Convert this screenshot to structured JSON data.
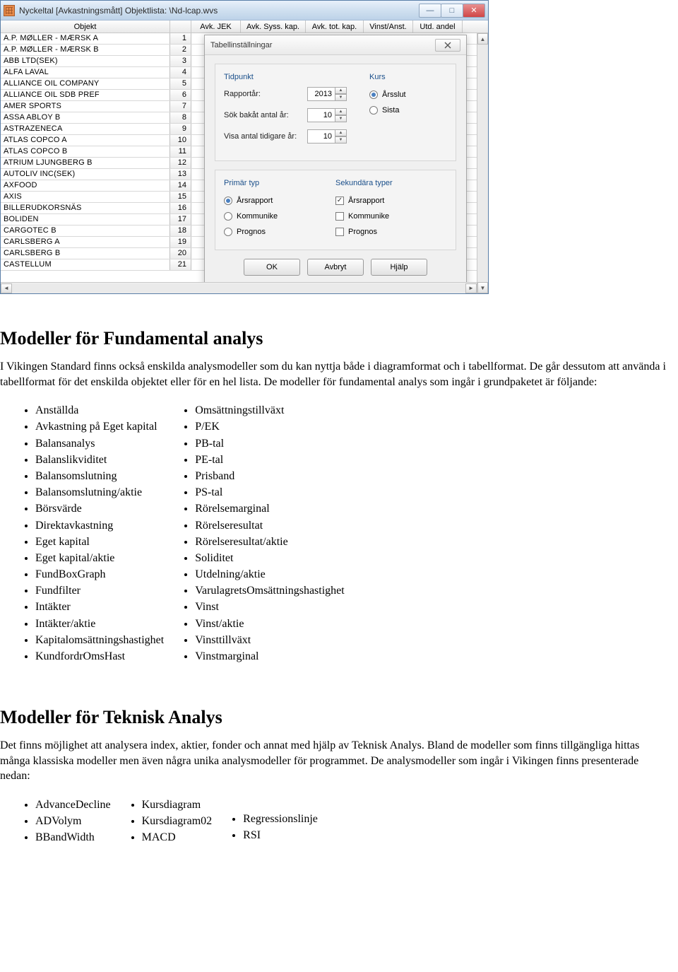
{
  "window": {
    "title": "Nyckeltal [Avkastningsmått] Objektlista: \\Nd-lcap.wvs",
    "columns": [
      "Objekt",
      "Avk. JEK",
      "Avk. Syss. kap.",
      "Avk. tot. kap.",
      "Vinst/Anst.",
      "Utd. andel"
    ],
    "rows": [
      {
        "name": "A.P. MØLLER - MÆRSK A",
        "idx": "1"
      },
      {
        "name": "A.P. MØLLER - MÆRSK B",
        "idx": "2"
      },
      {
        "name": "ABB LTD(SEK)",
        "idx": "3"
      },
      {
        "name": "ALFA LAVAL",
        "idx": "4"
      },
      {
        "name": "ALLIANCE OIL COMPANY",
        "idx": "5"
      },
      {
        "name": "ALLIANCE OIL SDB PREF",
        "idx": "6"
      },
      {
        "name": "AMER SPORTS",
        "idx": "7"
      },
      {
        "name": "ASSA ABLOY B",
        "idx": "8"
      },
      {
        "name": "ASTRAZENECA",
        "idx": "9"
      },
      {
        "name": "ATLAS COPCO A",
        "idx": "10"
      },
      {
        "name": "ATLAS COPCO B",
        "idx": "11"
      },
      {
        "name": "ATRIUM LJUNGBERG B",
        "idx": "12"
      },
      {
        "name": "AUTOLIV INC(SEK)",
        "idx": "13"
      },
      {
        "name": "AXFOOD",
        "idx": "14"
      },
      {
        "name": "AXIS",
        "idx": "15"
      },
      {
        "name": "BILLERUDKORSNÄS",
        "idx": "16"
      },
      {
        "name": "BOLIDEN",
        "idx": "17"
      },
      {
        "name": "CARGOTEC B",
        "idx": "18"
      },
      {
        "name": "CARLSBERG A",
        "idx": "19"
      },
      {
        "name": "CARLSBERG B",
        "idx": "20"
      },
      {
        "name": "CASTELLUM",
        "idx": "21"
      }
    ]
  },
  "dialog": {
    "title": "Tabellinställningar",
    "group1": {
      "head_left": "Tidpunkt",
      "head_right": "Kurs",
      "rapportar_label": "Rapportår:",
      "rapportar_value": "2013",
      "sok_label": "Sök bakåt antal år:",
      "sok_value": "10",
      "visa_label": "Visa antal tidigare år:",
      "visa_value": "10",
      "kurs_arsslut": "Årsslut",
      "kurs_sista": "Sista"
    },
    "group2": {
      "head_left": "Primär typ",
      "head_right": "Sekundära typer",
      "opt_arsrapport": "Årsrapport",
      "opt_kommunike": "Kommunike",
      "opt_prognos": "Prognos"
    },
    "btn_ok": "OK",
    "btn_cancel": "Avbryt",
    "btn_help": "Hjälp"
  },
  "doc": {
    "h1": "Modeller för Fundamental analys",
    "p1": "I Vikingen Standard finns också enskilda analysmodeller som du kan nyttja både i diagramformat och i tabellformat. De går dessutom att använda i tabellformat för det enskilda objektet eller för en hel lista. De modeller för fundamental analys som ingår i grundpaketet är följande:",
    "list1_left": [
      "Anställda",
      "Avkastning på Eget kapital",
      "Balansanalys",
      "Balanslikviditet",
      "Balansomslutning",
      "Balansomslutning/aktie",
      "Börsvärde",
      "Direktavkastning",
      "Eget kapital",
      "Eget kapital/aktie",
      "FundBoxGraph",
      "Fundfilter",
      "Intäkter",
      "Intäkter/aktie",
      "Kapitalomsättningshastighet",
      "KundfordrOmsHast"
    ],
    "list1_right": [
      "Omsättningstillväxt",
      "P/EK",
      "PB-tal",
      "PE-tal",
      "Prisband",
      "PS-tal",
      "Rörelsemarginal",
      "Rörelseresultat",
      "Rörelseresultat/aktie",
      "Soliditet",
      "Utdelning/aktie",
      "VarulagretsOmsättningshastighet",
      "Vinst",
      "Vinst/aktie",
      "Vinsttillväxt",
      "Vinstmarginal"
    ],
    "h2": "Modeller för Teknisk Analys",
    "p2": "Det finns möjlighet att analysera index, aktier, fonder och annat med hjälp av Teknisk Analys. Bland de modeller som finns tillgängliga hittas många klassiska modeller men även några unika analysmodeller för programmet. De analysmodeller som ingår i Vikingen finns presenterade nedan:",
    "list2_col1": [
      "AdvanceDecline",
      "ADVolym",
      "BBandWidth"
    ],
    "list2_col2": [
      "Kursdiagram",
      "Kursdiagram02",
      "MACD"
    ],
    "list2_col3": [
      "Regressionslinje",
      "RSI"
    ]
  }
}
